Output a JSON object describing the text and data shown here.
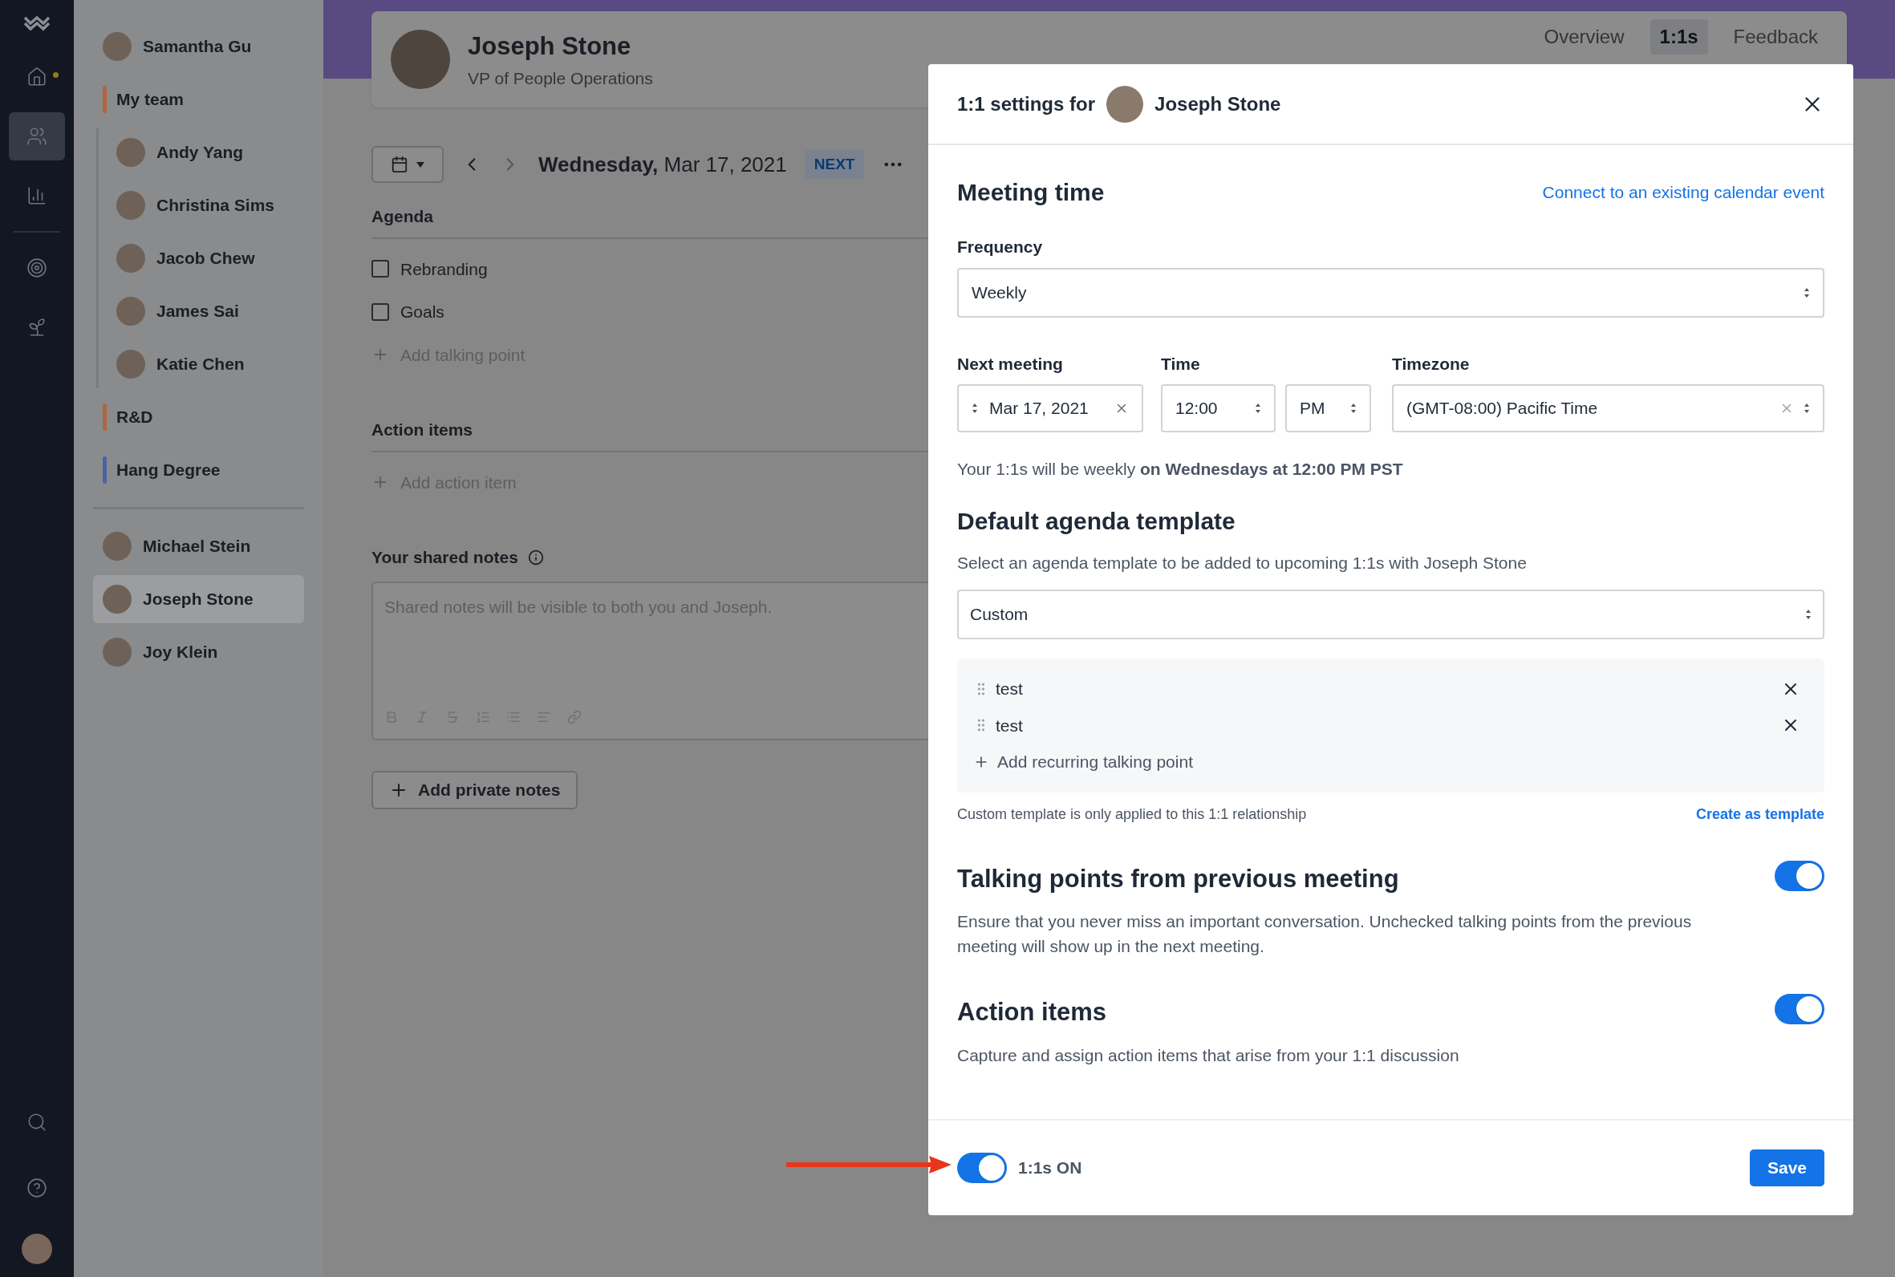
{
  "rail": {
    "items": [
      {
        "kind": "home",
        "selected": false,
        "unread": true
      },
      {
        "kind": "people",
        "selected": true,
        "unread": false
      },
      {
        "kind": "chart",
        "selected": false,
        "unread": false
      },
      {
        "kind": "target",
        "selected": false,
        "unread": false
      },
      {
        "kind": "lotus",
        "selected": false,
        "unread": false
      }
    ]
  },
  "people": [
    {
      "kind": "person",
      "name": "Samantha Gu",
      "selected": false
    },
    {
      "kind": "group",
      "name": "My team",
      "color": "#b0663e",
      "selected": false,
      "children": [
        {
          "kind": "person",
          "name": "Andy Yang",
          "selected": false
        },
        {
          "kind": "person",
          "name": "Christina Sims",
          "selected": false
        },
        {
          "kind": "person",
          "name": "Jacob Chew",
          "selected": false
        },
        {
          "kind": "person",
          "name": "James Sai",
          "selected": false
        },
        {
          "kind": "person",
          "name": "Katie Chen",
          "selected": false
        }
      ]
    },
    {
      "kind": "group",
      "name": "R&D",
      "color": "#b0663e",
      "selected": false
    },
    {
      "kind": "group",
      "name": "Hang Degree",
      "color": "#4e62a8",
      "selected": false
    },
    {
      "kind": "divider"
    },
    {
      "kind": "person",
      "name": "Michael Stein",
      "selected": false
    },
    {
      "kind": "person",
      "name": "Joseph Stone",
      "selected": true
    },
    {
      "kind": "person",
      "name": "Joy Klein",
      "selected": false
    }
  ],
  "header": {
    "name": "Joseph Stone",
    "title": "VP of People Operations",
    "tabs": [
      {
        "label": "Overview",
        "selected": false
      },
      {
        "label": "1:1s",
        "selected": true
      },
      {
        "label": "Feedback",
        "selected": false
      }
    ]
  },
  "date_bar": {
    "weekday": "Wednesday,",
    "date": "Mar 17, 2021",
    "badge": "NEXT"
  },
  "agenda": {
    "heading": "Agenda",
    "items": [
      {
        "text": "Rebranding",
        "checked": false
      },
      {
        "text": "Goals",
        "checked": false
      }
    ],
    "add": "Add talking point"
  },
  "action_items": {
    "heading": "Action items",
    "add": "Add action item"
  },
  "shared_notes": {
    "heading": "Your shared notes",
    "placeholder": "Shared notes will be visible to both you and Joseph."
  },
  "private_notes_button": "Add private notes",
  "modal": {
    "title": "1:1 settings for",
    "person": "Joseph Stone",
    "meeting_time": {
      "heading": "Meeting time",
      "link": "Connect to an existing calendar event",
      "frequency_label": "Frequency",
      "frequency": "Weekly",
      "next_label": "Next meeting",
      "next": "Mar 17, 2021",
      "time_label": "Time",
      "time": "12:00",
      "ampm": "PM",
      "timezone_label": "Timezone",
      "timezone": "(GMT-08:00) Pacific Time",
      "summary": "Your 1:1s will be weekly **on Wednesdays at 12:00 PM PST**"
    },
    "template": {
      "heading": "Default agenda template",
      "description": "Select an agenda template to be added to upcoming 1:1s with Joseph Stone",
      "value": "Custom",
      "items": [
        "test",
        "test"
      ],
      "add": "Add recurring talking point",
      "note": "Custom template is only applied to this 1:1 relationship",
      "link": "Create as template"
    },
    "toggles": [
      {
        "title": "Talking points from previous meeting",
        "description": "Ensure that you never miss an important conversation. Unchecked talking points from the previous meeting will show up in the next meeting.",
        "on": true
      },
      {
        "title": "Action items",
        "description": "Capture and assign action items that arise from your 1:1 discussion",
        "on": true
      }
    ],
    "footer": {
      "label": "1:1s ON",
      "on": true,
      "save": "Save"
    }
  }
}
